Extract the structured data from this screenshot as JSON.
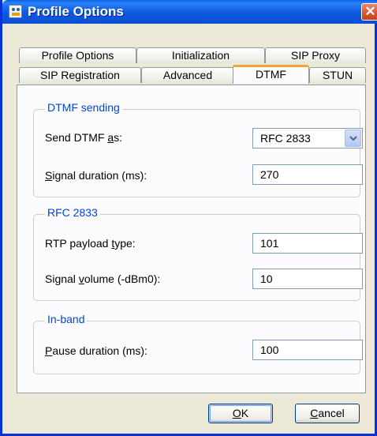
{
  "window": {
    "title": "Profile Options",
    "close_glyph": "✕"
  },
  "tabs_back": [
    {
      "label": "Profile Options"
    },
    {
      "label": "Initialization"
    },
    {
      "label": "SIP Proxy"
    }
  ],
  "tabs_front": [
    {
      "label": "SIP Registration",
      "active": false
    },
    {
      "label": "Advanced",
      "active": false
    },
    {
      "label": "DTMF",
      "active": true
    },
    {
      "label": "STUN",
      "active": false
    }
  ],
  "groups": {
    "dtmf_sending": {
      "legend": "DTMF sending",
      "send_as_label_pre": "Send DTMF ",
      "send_as_label_accel": "a",
      "send_as_label_post": "s:",
      "send_as_value": "RFC 2833",
      "duration_label_accel": "S",
      "duration_label_rest": "ignal duration (ms):",
      "duration_value": "270"
    },
    "rfc2833": {
      "legend": "RFC 2833",
      "payload_label_pre": "RTP payload ",
      "payload_label_accel": "t",
      "payload_label_post": "ype:",
      "payload_value": "101",
      "volume_label_pre": "Signal ",
      "volume_label_accel": "v",
      "volume_label_post": "olume (-dBm0):",
      "volume_value": "10"
    },
    "in_band": {
      "legend": "In-band",
      "pause_label_accel": "P",
      "pause_label_rest": "ause duration (ms):",
      "pause_value": "100"
    }
  },
  "buttons": {
    "ok_accel": "O",
    "ok_rest": "K",
    "cancel_accel": "C",
    "cancel_rest": "ancel"
  },
  "icons": {
    "app": "profile-app-icon",
    "dropdown": "chevron-down-icon",
    "close": "close-icon"
  },
  "colors": {
    "titlebar": "#0a5fe8",
    "active_tab_highlight": "#f2a33a",
    "group_legend": "#0046d5"
  }
}
